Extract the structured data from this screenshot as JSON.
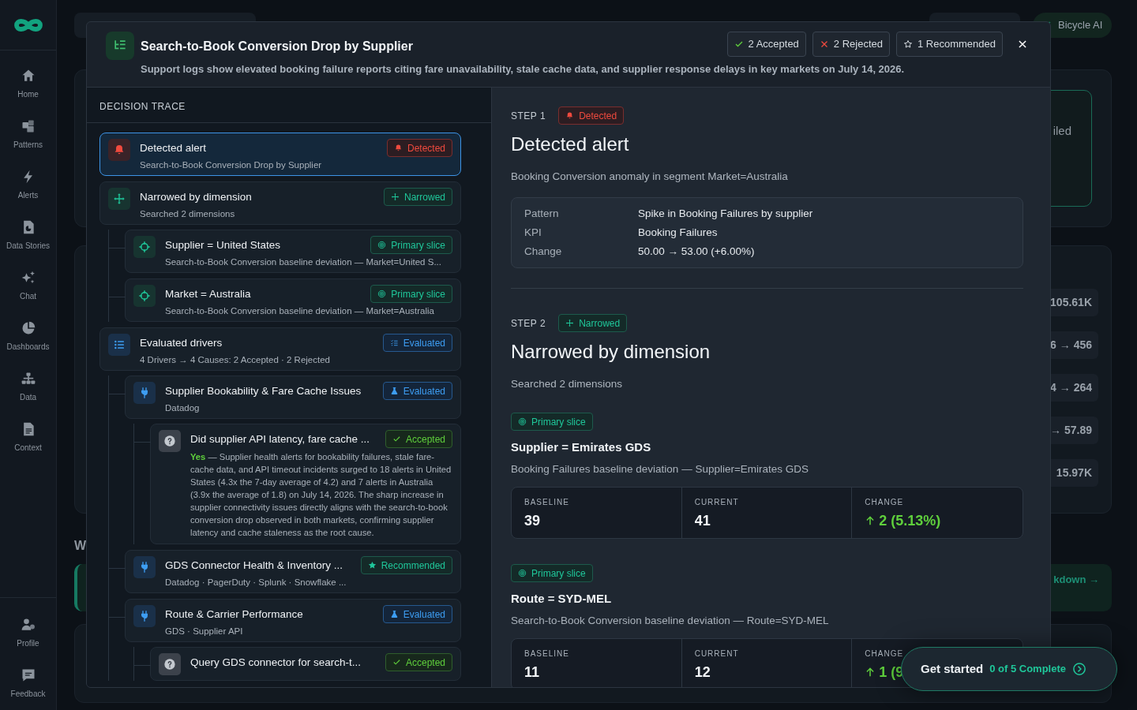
{
  "sidebar": {
    "items": [
      {
        "label": "Home",
        "kind": "home"
      },
      {
        "label": "Patterns",
        "kind": "patterns"
      },
      {
        "label": "Alerts",
        "kind": "alerts"
      },
      {
        "label": "Data Stories",
        "kind": "stories"
      },
      {
        "label": "Chat",
        "kind": "chat"
      },
      {
        "label": "Dashboards",
        "kind": "dashboards"
      },
      {
        "label": "Data",
        "kind": "data"
      },
      {
        "label": "Context",
        "kind": "context"
      }
    ],
    "footer_items": [
      {
        "label": "Profile",
        "kind": "profile"
      },
      {
        "label": "Feedback",
        "kind": "feedback"
      }
    ]
  },
  "background": {
    "assistant_button": "Bicycle AI",
    "card_text": "iled",
    "metrics": [
      "105.61K",
      "6 → 456",
      "4 → 264",
      "→ 57.89",
      "15.97K"
    ],
    "heading": "W",
    "link": "kdown →"
  },
  "modal": {
    "title": "Search-to-Book Conversion Drop by Supplier",
    "summary": "Support logs show elevated booking failure reports citing fare unavailability, stale cache data, and supplier response delays in key markets on July 14, 2026.",
    "counts": [
      {
        "kind": "accepted",
        "label": "2 Accepted"
      },
      {
        "kind": "rejected",
        "label": "2 Rejected"
      },
      {
        "kind": "recommended",
        "label": "1 Recommended"
      }
    ],
    "trace_title": "DECISION TRACE",
    "trace": [
      {
        "kind": "detected",
        "selected": true,
        "title": "Detected alert",
        "subtitle": "Search-to-Book Conversion Drop by Supplier",
        "badge": {
          "kind": "detected",
          "text": "Detected"
        }
      },
      {
        "kind": "narrowed",
        "selected": false,
        "title": "Narrowed by dimension",
        "subtitle": "Searched 2 dimensions",
        "badge": {
          "kind": "narrowed",
          "text": "Narrowed"
        },
        "children": [
          {
            "kind": "slice",
            "selected": false,
            "title": "Supplier = United States",
            "subtitle": "Search-to-Book Conversion baseline deviation — Market=United S...",
            "badge": {
              "kind": "slice",
              "text": "Primary slice"
            }
          },
          {
            "kind": "slice",
            "selected": false,
            "title": "Market = Australia",
            "subtitle": "Search-to-Book Conversion baseline deviation — Market=Australia",
            "badge": {
              "kind": "slice",
              "text": "Primary slice"
            }
          }
        ]
      },
      {
        "kind": "summary",
        "selected": false,
        "title": "Evaluated drivers",
        "subtitle": "4 Drivers → 4 Causes: 2 Accepted · 2 Rejected",
        "badge": {
          "kind": "summary",
          "text": "Evaluated"
        },
        "children": [
          {
            "kind": "driver",
            "selected": false,
            "title": "Supplier Bookability & Fare Cache Issues",
            "subtitle": "Datadog",
            "badge": {
              "kind": "evaluated",
              "text": "Evaluated"
            },
            "children": [
              {
                "kind": "cause",
                "selected": false,
                "title": "Did supplier API latency, fare cache ...",
                "verdict": "Yes",
                "text": "— Supplier health alerts for bookability failures, stale fare-cache data, and API timeout incidents surged to 18 alerts in United States (4.3x the 7-day average of 4.2) and 7 alerts in Australia (3.9x the average of 1.8) on July 14, 2026. The sharp increase in supplier connectivity issues directly aligns with the search-to-book conversion drop observed in both markets, confirming supplier latency and cache staleness as the root cause.",
                "badge": {
                  "kind": "accepted",
                  "text": "Accepted"
                }
              }
            ]
          },
          {
            "kind": "driver",
            "selected": false,
            "title": "GDS Connector Health & Inventory ...",
            "subtitle": "Datadog · PagerDuty · Splunk · Snowflake ...",
            "badge": {
              "kind": "recommended",
              "text": "Recommended"
            }
          },
          {
            "kind": "driver",
            "selected": false,
            "title": "Route & Carrier Performance",
            "subtitle": "GDS · Supplier API",
            "badge": {
              "kind": "evaluated",
              "text": "Evaluated"
            },
            "children": [
              {
                "kind": "cause",
                "selected": false,
                "title": "Query GDS connector for search-t...",
                "badge": {
                  "kind": "accepted",
                  "text": "Accepted"
                }
              }
            ]
          }
        ]
      }
    ],
    "steps": [
      {
        "label": "STEP 1",
        "badge": {
          "kind": "detected",
          "text": "Detected"
        },
        "title": "Detected alert",
        "description": "Booking Conversion anomaly in segment Market=Australia",
        "details": [
          {
            "label": "Pattern",
            "value": "Spike in Booking Failures by supplier"
          },
          {
            "label": "KPI",
            "value": "Booking Failures"
          },
          {
            "label": "Change",
            "value": "50.00 → 53.00 (+6.00%)"
          }
        ]
      },
      {
        "label": "STEP 2",
        "badge": {
          "kind": "narrowed",
          "text": "Narrowed"
        },
        "title": "Narrowed by dimension",
        "description": "Searched 2 dimensions",
        "slices": [
          {
            "badge": {
              "kind": "slice",
              "text": "Primary slice"
            },
            "title": "Supplier = Emirates GDS",
            "description": "Booking Failures baseline deviation — Supplier=Emirates GDS",
            "metrics": [
              {
                "label": "BASELINE",
                "value": "39"
              },
              {
                "label": "CURRENT",
                "value": "41"
              },
              {
                "label": "CHANGE",
                "value": "2 (5.13%)",
                "up": true
              }
            ]
          },
          {
            "badge": {
              "kind": "slice",
              "text": "Primary slice"
            },
            "title": "Route = SYD-MEL",
            "description": "Search-to-Book Conversion baseline deviation — Route=SYD-MEL",
            "metrics": [
              {
                "label": "BASELINE",
                "value": "11"
              },
              {
                "label": "CURRENT",
                "value": "12"
              },
              {
                "label": "CHANGE",
                "value": "1 (9",
                "up": true
              }
            ]
          }
        ]
      }
    ]
  },
  "onboarding": {
    "label": "Get started",
    "progress": "0 of 5 Complete"
  }
}
